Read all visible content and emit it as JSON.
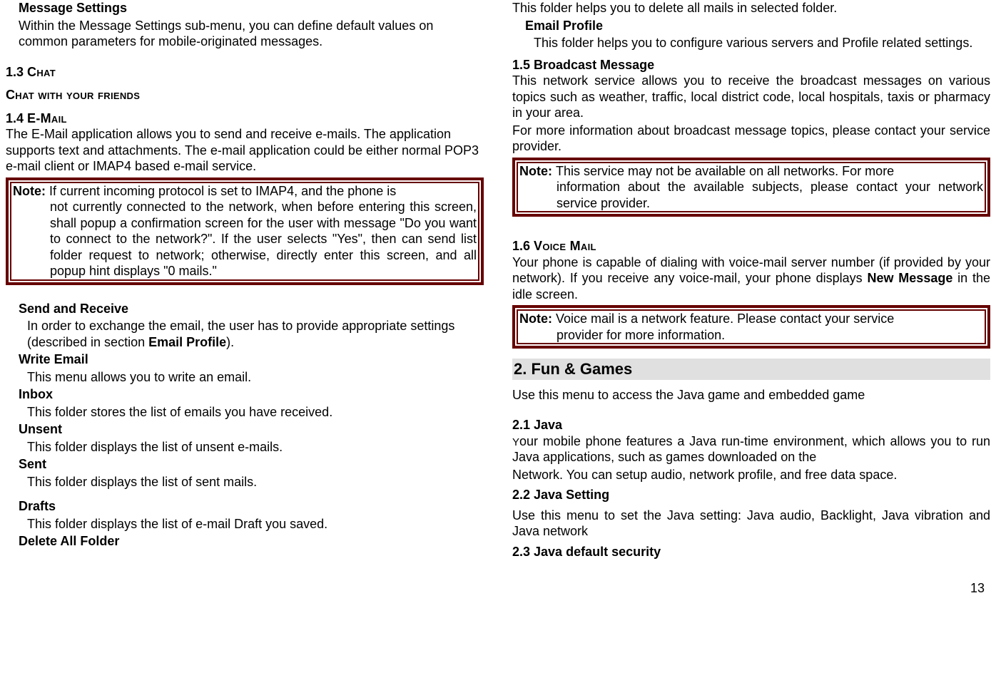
{
  "left": {
    "msg_settings_title": "Message Settings",
    "msg_settings_body": "Within the Message Settings sub-menu, you can define default values on common parameters for mobile-originated messages.",
    "s13_num": "1.3 ",
    "s13_title": "Chat",
    "s13_sub": "Chat with your friends",
    "s14_num": "1.4 ",
    "s14_title": "E-Mail",
    "s14_body": "The E-Mail application allows you to send and receive e-mails. The application supports text and attachments. The e-mail application could be either normal POP3 e-mail client or IMAP4 based e-mail service.",
    "note1_label": "Note: ",
    "note1_first": "If current incoming protocol is set to IMAP4, and the phone is",
    "note1_rest": "not currently connected to the network, when before entering this screen, shall popup a confirmation screen for the user with message \"Do you want to connect to the network?\". If the user selects \"Yes\", then can send list folder request to network; otherwise, directly enter this screen, and all popup hint displays \"0 mails.\"",
    "send_title": "Send and Receive",
    "send_body_a": "In order to exchange the email, the user has to provide appropriate settings (described in section ",
    "send_body_bold": "Email Profile",
    "send_body_b": ").",
    "write_title": "Write Email",
    "write_body": "This menu allows you to write an email.",
    "inbox_title": "Inbox",
    "inbox_body": "This folder stores the list of emails you have received.",
    "unsent_title": "Unsent",
    "unsent_body": "This folder displays the list of unsent e-mails.",
    "sent_title": "Sent",
    "sent_body": "This folder displays the list of sent mails.",
    "drafts_title": "Drafts",
    "drafts_body": "This folder displays the list of e-mail Draft you saved.",
    "delete_title": "Delete All Folder"
  },
  "right": {
    "delete_body": "This folder helps you to delete all mails in selected folder.",
    "emailprof_title": "Email Profile",
    "emailprof_body": "This folder helps you to configure various servers and Profile related settings.",
    "s15_num": "1",
    "s15_title": ".5 Broadcast Message",
    "s15_body1": "This network service allows you to receive the broadcast messages on various topics such as weather, traffic, local district code, local hospitals, taxis or pharmacy in your area.",
    "s15_body2": "For more information about broadcast message topics, please contact your service provider.",
    "note2_label": "Note: ",
    "note2_first": "This service may not be available on all networks. For more",
    "note2_rest": "information about the available subjects, please contact your network service provider.",
    "s16_num": "1",
    "s16_titlepart": ".6 ",
    "s16_title": "Voice Mail",
    "s16_body_a": "Your phone is capable of dialing with voice-mail server number (if provided by your network). If you receive any voice-mail, your phone displays ",
    "s16_body_bold": "New Message",
    "s16_body_b": " in the idle screen.",
    "note3_label": "Note: ",
    "note3_first": "Voice mail is a network feature. Please contact your service",
    "note3_rest": "provider for more information.",
    "s2_title": "2. Fun & Games",
    "s2_intro": "Use this menu to access the Java game and embedded game",
    "s21_title": "2.1 Java",
    "s21_y": "Y",
    "s21_body": "our mobile phone features a Java run-time environment, which allows you to run Java applications, such as games downloaded on the",
    "s21_body2": "Network. You can setup audio, network profile, and free data space.",
    "s22_title": "2.2 Java Setting",
    "s22_body": "Use this menu to set the Java setting: Java audio, Backlight, Java vibration and Java network",
    "s23_title": "2.3 Java default security"
  },
  "page_number": "13"
}
